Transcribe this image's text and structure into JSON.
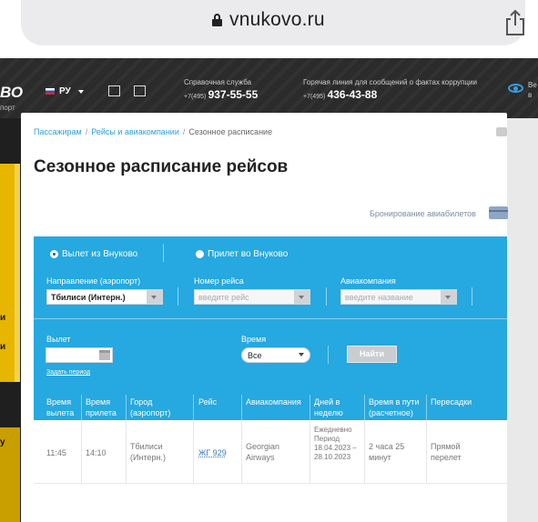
{
  "browser": {
    "url": "vnukovo.ru"
  },
  "header": {
    "logo_fragment": "ВО",
    "logo_sub": "порт",
    "lang": "РУ",
    "help": {
      "title": "Справочная служба",
      "code": "+7(495)",
      "number": "937-55-55"
    },
    "hotline": {
      "title": "Горячая линия для сообщений о фактах коррупции",
      "code": "+7(495)",
      "number": "436-43-88"
    },
    "eye_label": "Ве\nв"
  },
  "left_letters": [
    "и",
    "и",
    "у"
  ],
  "breadcrumb": {
    "items": [
      "Пассажирам",
      "Рейсы и авиакомпании"
    ],
    "current": "Сезонное расписание"
  },
  "page_title": "Сезонное расписание рейсов",
  "booking_link": "Бронирование авиабилетов",
  "form": {
    "radio_departure": "Вылет из Внуково",
    "radio_arrival": "Прилет во Внуково",
    "direction_label": "Направление (аэропорт)",
    "direction_value": "Тбилиси (Интерн.)",
    "flight_label": "Номер рейса",
    "flight_placeholder": "введите рейс",
    "airline_label": "Авиакомпания",
    "airline_placeholder": "введите название",
    "departure_label": "Вылет",
    "period_link": "Задать период",
    "time_label": "Время",
    "time_value": "Все",
    "find_button": "Найти"
  },
  "table": {
    "headers": [
      "Время\nвылета",
      "Время\nприлета",
      "Город\n(аэропорт)",
      "Рейс",
      "Авиакомпания",
      "Дней в\nнеделю",
      "Время в пути\n(расчетное)",
      "Пересадки"
    ],
    "rows": [
      {
        "dep": "11:45",
        "arr": "14:10",
        "city": "Тбилиси\n(Интерн.)",
        "flight": "ЖГ 929",
        "airline": "Georgian\nAirways",
        "days": "Ежедневно\nПериод\n18.04.2023 –\n28.10.2023",
        "duration": "2 часа 25\nминут",
        "transfers": "Прямой\nперелет"
      }
    ]
  }
}
